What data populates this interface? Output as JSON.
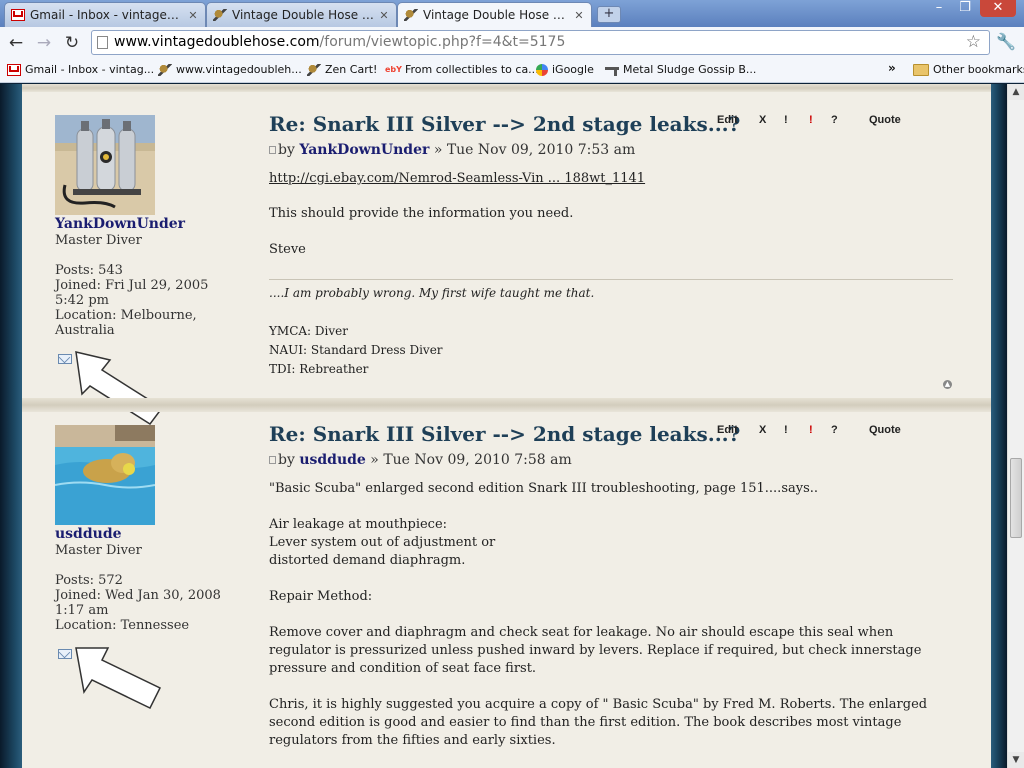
{
  "browser": {
    "tabs": [
      {
        "title": "Gmail - Inbox - vintagedou...",
        "icon": "gmail-icon"
      },
      {
        "title": "Vintage Double Hose • Post...",
        "icon": "diver-icon"
      },
      {
        "title": "Vintage Double Hose • Vie...",
        "icon": "diver-icon"
      }
    ],
    "new_tab_symbol": "+",
    "window_controls": {
      "minimize": "–",
      "maximize": "❐",
      "close": "✕"
    },
    "url_host": "www.vintagedoublehose.com",
    "url_path": "/forum/viewtopic.php?f=4&t=5175",
    "bookmarks": [
      {
        "label": "Gmail - Inbox - vintag...",
        "icon": "gmail-icon"
      },
      {
        "label": "www.vintagedoubleh...",
        "icon": "diver-icon"
      },
      {
        "label": "Zen Cart!",
        "icon": "diver-icon"
      },
      {
        "label": "From collectibles to ca...",
        "icon": "ebay-icon"
      },
      {
        "label": "iGoogle",
        "icon": "google-icon"
      },
      {
        "label": "Metal Sludge Gossip B...",
        "icon": "gun-icon"
      }
    ],
    "bookmarks_overflow": "»",
    "other_bookmarks": "Other bookmarks"
  },
  "post_actions": {
    "edit": "Edit",
    "delete": "X",
    "report": "!",
    "warn": "!",
    "info": "?",
    "quote": "Quote"
  },
  "posts": [
    {
      "title": "Re: Snark III Silver --> 2nd stage leaks...?",
      "by": "by",
      "author": "YankDownUnder",
      "date": "» Tue Nov 09, 2010 7:53 am",
      "rank": "Master Diver",
      "posts": "Posts: 543",
      "joined": "Joined: Fri Jul 29, 2005 5:42 pm",
      "location": "Location: Melbourne, Australia",
      "link": "http://cgi.ebay.com/Nemrod-Seamless-Vin ... 188wt_1141",
      "text1": "This should provide the information you need.",
      "text2": "Steve",
      "signature_quote": "....I am probably wrong. My first wife taught me that.",
      "signature_lines": [
        "YMCA: Diver",
        "NAUI: Standard Dress Diver",
        "TDI: Rebreather"
      ]
    },
    {
      "title": "Re: Snark III Silver --> 2nd stage leaks...?",
      "by": "by",
      "author": "usddude",
      "date": "» Tue Nov 09, 2010 7:58 am",
      "rank": "Master Diver",
      "posts": "Posts: 572",
      "joined": "Joined: Wed Jan 30, 2008 1:17 am",
      "location": "Location: Tennessee",
      "paragraphs": [
        "\"Basic Scuba\" enlarged second edition Snark III troubleshooting, page 151....says..",
        "Air leakage at mouthpiece:\nLever system out of adjustment or\ndistorted demand diaphragm.",
        "Repair Method:",
        "Remove cover and diaphragm and check seat for leakage. No air should escape this seal when regulator is pressurized unless pushed inward by levers. Replace if required, but check innerstage pressure and condition of seat face first.",
        "Chris, it is highly suggested you acquire a copy of \" Basic Scuba\" by Fred M. Roberts. The enlarged second edition is good and easier to find than the first edition. The book describes most vintage regulators from the fifties and early sixties."
      ]
    }
  ]
}
